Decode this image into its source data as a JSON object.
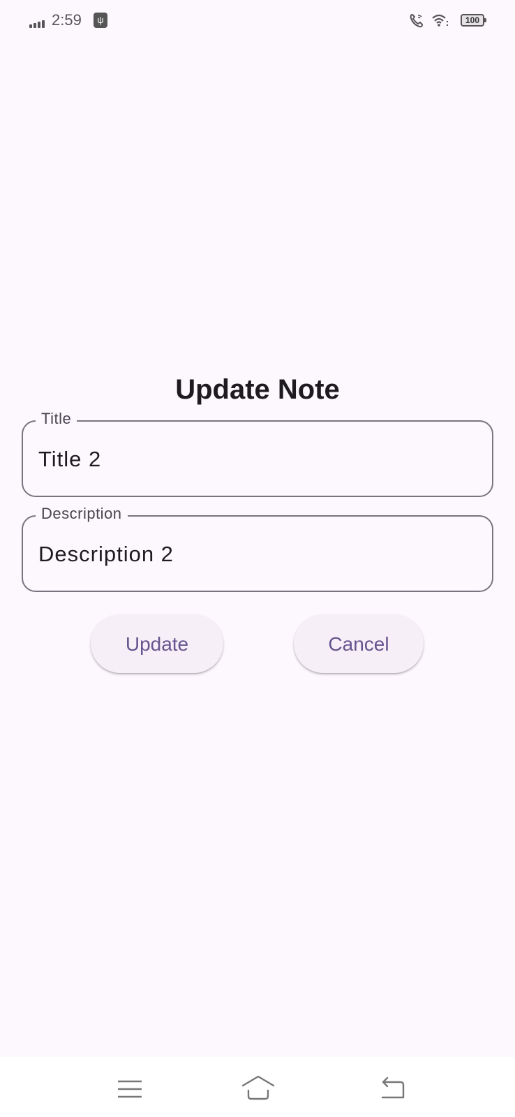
{
  "status_bar": {
    "time": "2:59",
    "battery": "100",
    "icons": [
      "signal-icon",
      "usb-icon",
      "wifi-call-icon",
      "wifi-icon",
      "battery-icon"
    ]
  },
  "dialog": {
    "title": "Update Note",
    "fields": [
      {
        "label": "Title",
        "value": "Title 2"
      },
      {
        "label": "Description",
        "value": "Description 2"
      }
    ],
    "update_label": "Update",
    "cancel_label": "Cancel"
  },
  "nav_bar": {
    "icons": [
      "menu-icon",
      "home-icon",
      "back-icon"
    ]
  },
  "colors": {
    "background": "#fdf7fe",
    "accent": "#65558f",
    "outline": "#79747e"
  }
}
